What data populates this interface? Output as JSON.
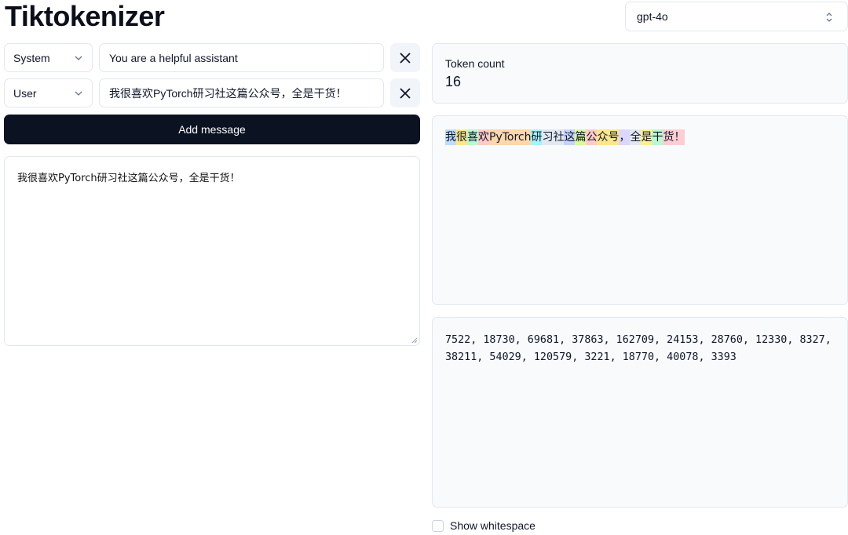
{
  "app": {
    "title": "Tiktokenizer"
  },
  "model": {
    "selected": "gpt-4o"
  },
  "messages": [
    {
      "role": "System",
      "content": "You are a helpful assistant"
    },
    {
      "role": "User",
      "content": "我很喜欢PyTorch研习社这篇公众号，全是干货！"
    }
  ],
  "add_message_label": "Add message",
  "prompt_text": "我很喜欢PyTorch研习社这篇公众号，全是干货！",
  "token_count": {
    "label": "Token count",
    "value": "16"
  },
  "tokens": [
    {
      "text": "我",
      "color": "#bfdbfe"
    },
    {
      "text": "很",
      "color": "#fde68a"
    },
    {
      "text": "喜",
      "color": "#bbf7d0"
    },
    {
      "text": "欢",
      "color": "#fecaca"
    },
    {
      "text": "PyTorch",
      "color": "#fed7aa"
    },
    {
      "text": "研",
      "color": "#a5f3fc"
    },
    {
      "text": "习社",
      "color": "#e2e8f0"
    },
    {
      "text": "这",
      "color": "#c7d2fe"
    },
    {
      "text": "篇",
      "color": "#d9f99d"
    },
    {
      "text": "公",
      "color": "#fecaca"
    },
    {
      "text": "众号",
      "color": "#fde68a"
    },
    {
      "text": "，",
      "color": "#ddd6fe"
    },
    {
      "text": "全",
      "color": "#e2e8f0"
    },
    {
      "text": "是",
      "color": "#fef08a"
    },
    {
      "text": "干",
      "color": "#bbf7d0"
    },
    {
      "text": "货！",
      "color": "#fecdd3"
    }
  ],
  "token_ids": "7522, 18730, 69681, 37863, 162709, 24153, 28760, 12330, 8327, 38211, 54029, 120579, 3221, 18770, 40078, 3393",
  "show_whitespace_label": "Show whitespace",
  "icons": {
    "close": "close-icon",
    "chevron": "chevron-down-icon",
    "updown": "chevron-up-down-icon"
  }
}
